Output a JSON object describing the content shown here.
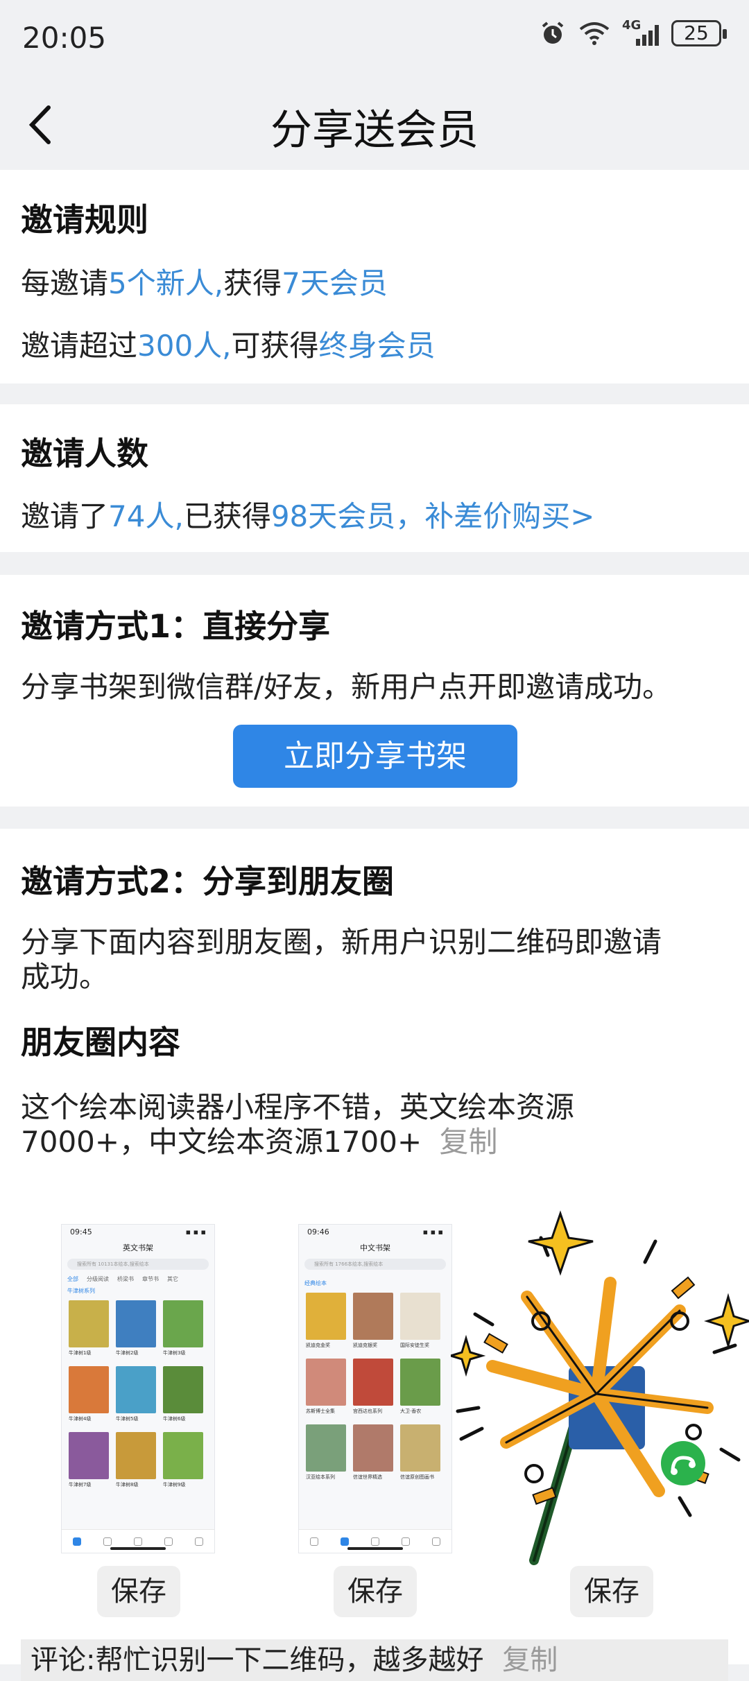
{
  "status_bar": {
    "time": "20:05",
    "network": "4G",
    "battery": "25"
  },
  "header": {
    "title": "分享送会员"
  },
  "rules": {
    "heading": "邀请规则",
    "line1_prefix": "每邀请",
    "line1_count": "5个新人,",
    "line1_mid": "获得",
    "line1_reward": "7天会员",
    "line2_prefix": "邀请超过",
    "line2_count": "300人,",
    "line2_mid": "可获得",
    "line2_reward": "终身会员"
  },
  "invite_count": {
    "heading": "邀请人数",
    "prefix": "邀请了",
    "count": "74人,",
    "mid": "已获得",
    "reward": "98天会员，",
    "buy_link": "补差价购买>"
  },
  "method1": {
    "heading": "邀请方式1：直接分享",
    "description": "分享书架到微信群/好友，新用户点开即邀请成功。",
    "button_label": "立即分享书架"
  },
  "method2": {
    "heading": "邀请方式2：分享到朋友圈",
    "description_line1": "分享下面内容到朋友圈，新用户识别二维码即邀请",
    "description_line2": "成功。",
    "content_heading": "朋友圈内容",
    "content_line1": "这个绘本阅读器小程序不错，英文绘本资源",
    "content_line2": "7000+，中文绘本资源1700+",
    "copy_label": "复制"
  },
  "thumbnails": [
    {
      "time": "09:45",
      "title": "英文书架",
      "search": "搜索所有 10131本绘本,搜索绘本",
      "tabs": [
        "全部",
        "分级阅读",
        "桥梁书",
        "章节书",
        "其它"
      ],
      "section": "牛津树系列",
      "books": [
        {
          "caption": "牛津树1级",
          "color": "#c8b04a"
        },
        {
          "caption": "牛津树2级",
          "color": "#3f7fc0"
        },
        {
          "caption": "牛津树3级",
          "color": "#6aa64c"
        },
        {
          "caption": "牛津树4级",
          "color": "#d9793a"
        },
        {
          "caption": "牛津树5级",
          "color": "#4aa0c8"
        },
        {
          "caption": "牛津树6级",
          "color": "#5a8c3a"
        },
        {
          "caption": "牛津树7级",
          "color": "#8a5a9c"
        },
        {
          "caption": "牛津树8级",
          "color": "#c89a3a"
        },
        {
          "caption": "牛津树9级",
          "color": "#7ab04a"
        }
      ]
    },
    {
      "time": "09:46",
      "title": "中文书架",
      "search": "搜索所有 1766本绘本,搜索绘本",
      "tabs": [],
      "section": "经典绘本",
      "books": [
        {
          "caption": "凯迪克金奖",
          "color": "#e0b03a"
        },
        {
          "caption": "凯迪克银奖",
          "color": "#b07a5a"
        },
        {
          "caption": "国际安徒生奖",
          "color": "#e8e0d0"
        },
        {
          "caption": "苏斯博士全集",
          "color": "#d08a7a"
        },
        {
          "caption": "宫西达也系列",
          "color": "#c04a3a"
        },
        {
          "caption": "大卫·香农",
          "color": "#6a9c4a"
        },
        {
          "caption": "汉亚绘本系列",
          "color": "#7aa07a"
        },
        {
          "caption": "信谊世界精选",
          "color": "#b07a6a"
        },
        {
          "caption": "信谊原创图画书",
          "color": "#c8b070"
        }
      ]
    }
  ],
  "save_label": "保存",
  "comment": {
    "prefix": "评论:帮忙识别一下二维码，越多越好",
    "copy_label": "复制"
  }
}
